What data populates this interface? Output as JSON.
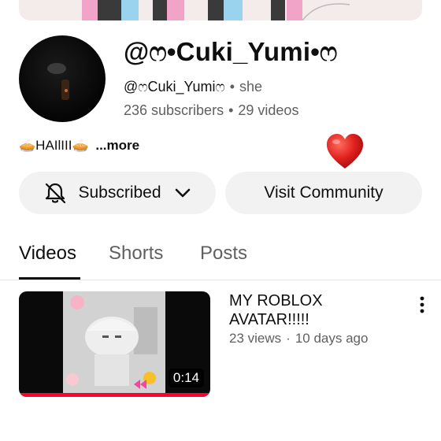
{
  "channel": {
    "name": "@ෆ•Cuki_Yumi•ෆ",
    "handle": "@ෆCuki_Yumiෆ",
    "pronouns": "she",
    "subscribers": "236 subscribers",
    "videos_count": "29 videos",
    "description": "🥧HAIlIII🥧",
    "more_label": "...more"
  },
  "actions": {
    "subscribed_label": "Subscribed",
    "community_label": "Visit Community"
  },
  "tabs": [
    {
      "label": "Videos"
    },
    {
      "label": "Shorts"
    },
    {
      "label": "Posts"
    }
  ],
  "videos": [
    {
      "title": "MY ROBLOX AVATAR!!!!!",
      "views": "23 views",
      "age": "10 days ago",
      "duration": "0:14"
    }
  ],
  "colors": {
    "progress": "#ff0033",
    "heart": "#e0201d",
    "pill_bg": "#f2f2f2"
  },
  "icons": [
    "bell-off-icon",
    "chevron-down-icon",
    "heart-icon",
    "more-vert-icon"
  ]
}
